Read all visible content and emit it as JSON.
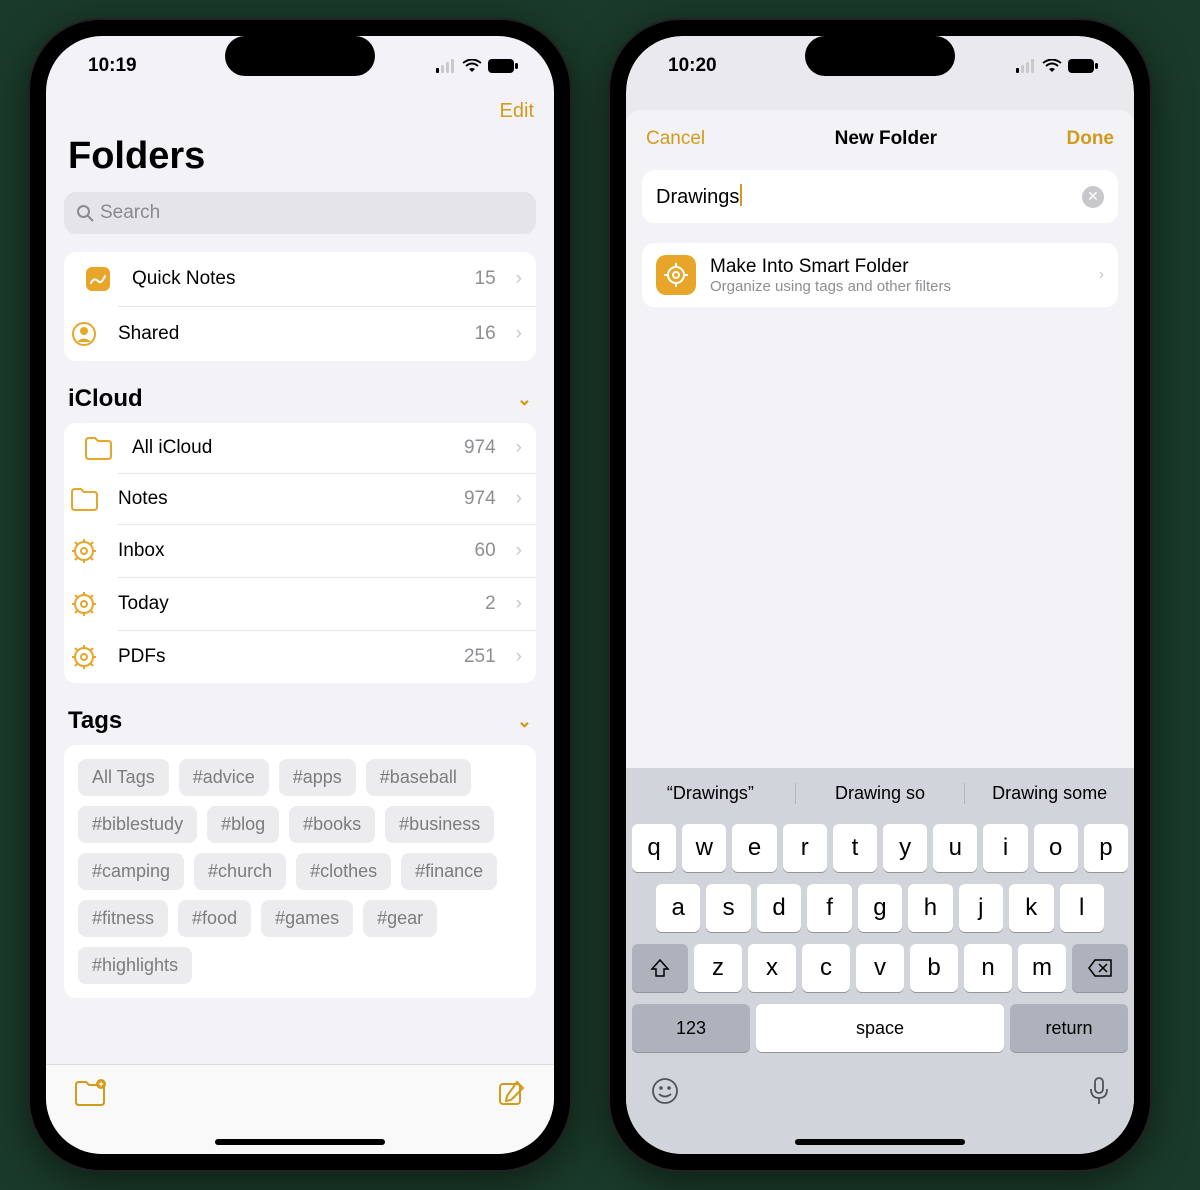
{
  "left": {
    "status": {
      "time": "10:19"
    },
    "nav": {
      "edit": "Edit"
    },
    "title": "Folders",
    "search": {
      "placeholder": "Search"
    },
    "top_rows": [
      {
        "icon": "quicknote",
        "label": "Quick Notes",
        "count": "15"
      },
      {
        "icon": "shared",
        "label": "Shared",
        "count": "16"
      }
    ],
    "sections": {
      "icloud": {
        "title": "iCloud",
        "rows": [
          {
            "icon": "folder",
            "label": "All iCloud",
            "count": "974"
          },
          {
            "icon": "folder",
            "label": "Notes",
            "count": "974"
          },
          {
            "icon": "gear",
            "label": "Inbox",
            "count": "60"
          },
          {
            "icon": "gear",
            "label": "Today",
            "count": "2"
          },
          {
            "icon": "gear",
            "label": "PDFs",
            "count": "251"
          }
        ]
      },
      "tags": {
        "title": "Tags",
        "items": [
          "All Tags",
          "#advice",
          "#apps",
          "#baseball",
          "#biblestudy",
          "#blog",
          "#books",
          "#business",
          "#camping",
          "#church",
          "#clothes",
          "#finance",
          "#fitness",
          "#food",
          "#games",
          "#gear",
          "#highlights"
        ]
      }
    }
  },
  "right": {
    "status": {
      "time": "10:20"
    },
    "modal": {
      "cancel": "Cancel",
      "title": "New Folder",
      "done": "Done",
      "input_value": "Drawings",
      "smart": {
        "title": "Make Into Smart Folder",
        "sub": "Organize using tags and other filters"
      }
    },
    "keyboard": {
      "suggestions": [
        "“Drawings”",
        "Drawing so",
        "Drawing some"
      ],
      "rows": {
        "r1": [
          "q",
          "w",
          "e",
          "r",
          "t",
          "y",
          "u",
          "i",
          "o",
          "p"
        ],
        "r2": [
          "a",
          "s",
          "d",
          "f",
          "g",
          "h",
          "j",
          "k",
          "l"
        ],
        "r3": [
          "z",
          "x",
          "c",
          "v",
          "b",
          "n",
          "m"
        ]
      },
      "num": "123",
      "space": "space",
      "ret": "return"
    }
  }
}
